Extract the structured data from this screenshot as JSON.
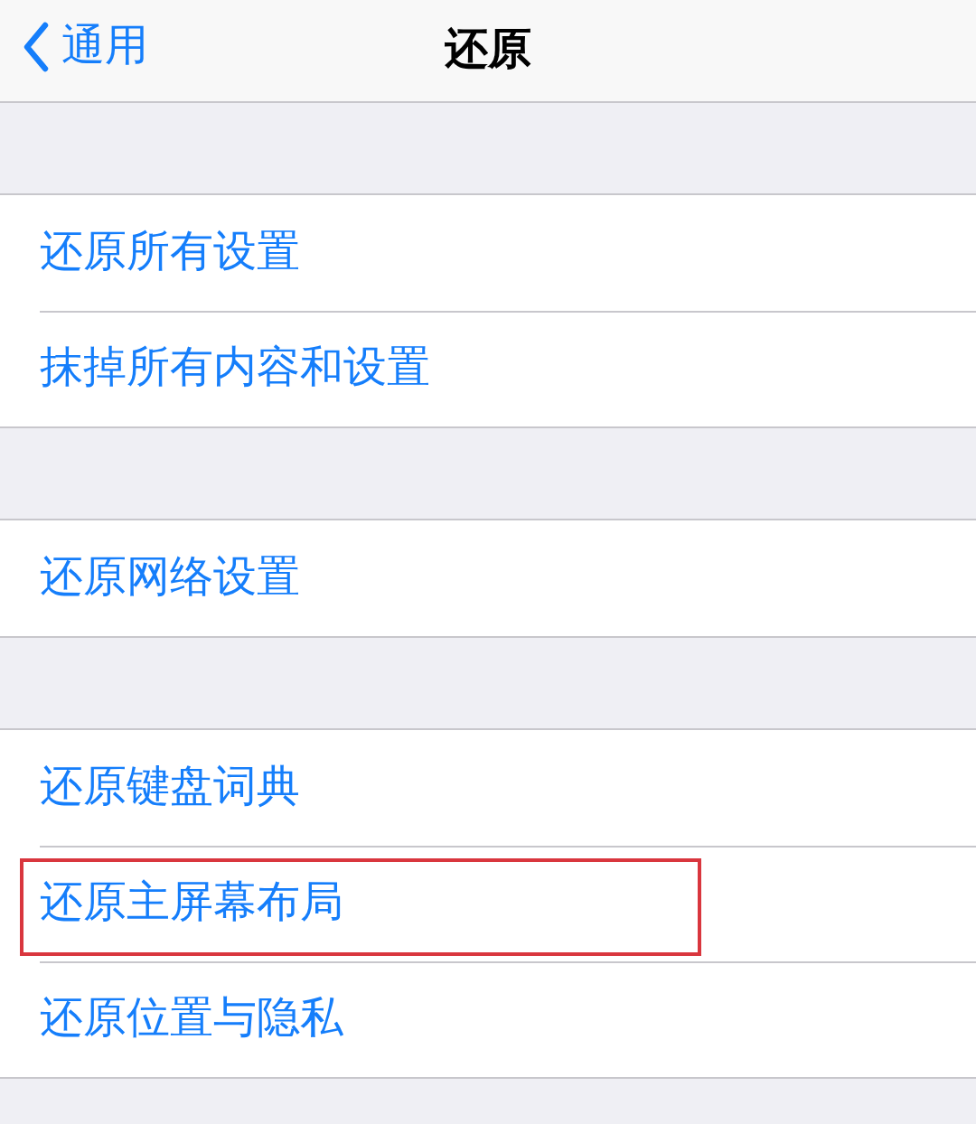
{
  "nav": {
    "back_label": "通用",
    "title": "还原"
  },
  "groups": [
    {
      "items": [
        {
          "label": "还原所有设置",
          "highlighted": false
        },
        {
          "label": "抹掉所有内容和设置",
          "highlighted": false
        }
      ]
    },
    {
      "items": [
        {
          "label": "还原网络设置",
          "highlighted": false
        }
      ]
    },
    {
      "items": [
        {
          "label": "还原键盘词典",
          "highlighted": false
        },
        {
          "label": "还原主屏幕布局",
          "highlighted": true
        },
        {
          "label": "还原位置与隐私",
          "highlighted": false
        }
      ]
    }
  ]
}
